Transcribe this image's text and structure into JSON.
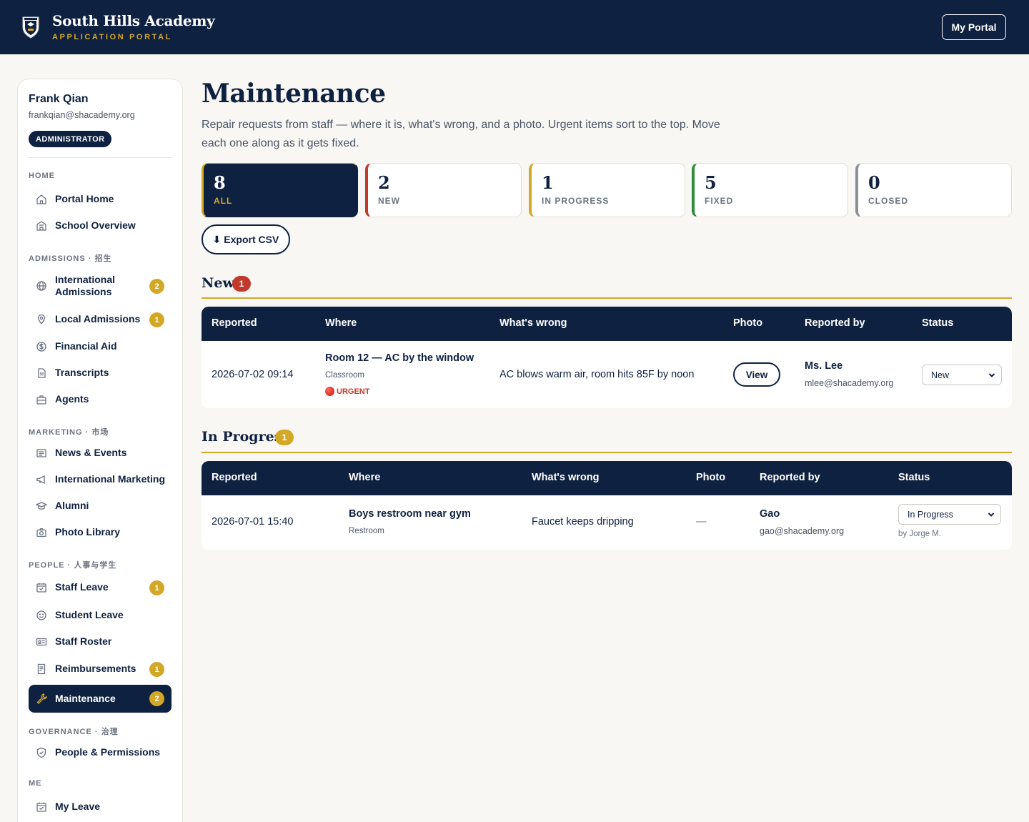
{
  "header": {
    "title": "South Hills Academy",
    "subtitle": "APPLICATION PORTAL",
    "portal_button": "My Portal"
  },
  "user": {
    "name": "Frank Qian",
    "email": "frankqian@shacademy.org",
    "role": "ADMINISTRATOR"
  },
  "nav": {
    "sections": {
      "home": "HOME",
      "admissions": "ADMISSIONS · 招生",
      "marketing": "MARKETING · 市场",
      "people": "PEOPLE · 人事与学生",
      "governance": "GOVERNANCE · 治理",
      "me": "ME"
    },
    "items": {
      "portal_home": {
        "label": "Portal Home",
        "icon": "home-icon"
      },
      "school_overview": {
        "label": "School Overview",
        "icon": "school-icon"
      },
      "international_admissions": {
        "label": "International Admissions",
        "icon": "globe-icon",
        "count": "2"
      },
      "local_admissions": {
        "label": "Local Admissions",
        "icon": "map-pin-icon",
        "count": "1"
      },
      "financial_aid": {
        "label": "Financial Aid",
        "icon": "dollar-icon"
      },
      "transcripts": {
        "label": "Transcripts",
        "icon": "document-icon"
      },
      "agents": {
        "label": "Agents",
        "icon": "briefcase-icon"
      },
      "news_events": {
        "label": "News & Events",
        "icon": "newspaper-icon"
      },
      "international_marketing": {
        "label": "International Marketing",
        "icon": "megaphone-icon"
      },
      "alumni": {
        "label": "Alumni",
        "icon": "graduation-cap-icon"
      },
      "photo_library": {
        "label": "Photo Library",
        "icon": "camera-icon"
      },
      "staff_leave": {
        "label": "Staff Leave",
        "icon": "calendar-check-icon",
        "count": "1"
      },
      "student_leave": {
        "label": "Student Leave",
        "icon": "smile-icon"
      },
      "staff_roster": {
        "label": "Staff Roster",
        "icon": "id-card-icon"
      },
      "reimbursements": {
        "label": "Reimbursements",
        "icon": "receipt-icon",
        "count": "1"
      },
      "maintenance": {
        "label": "Maintenance",
        "icon": "wrench-icon",
        "count": "2"
      },
      "people_permissions": {
        "label": "People & Permissions",
        "icon": "shield-icon"
      },
      "my_leave": {
        "label": "My Leave",
        "icon": "calendar-check-icon"
      }
    }
  },
  "page": {
    "title": "Maintenance",
    "description": "Repair requests from staff — where it is, what's wrong, and a photo. Urgent items sort to the top. Move each one along as it gets fixed."
  },
  "stats": [
    {
      "count": "8",
      "label": "ALL",
      "color": "#d4a827"
    },
    {
      "count": "2",
      "label": "NEW",
      "color": "#c0392b"
    },
    {
      "count": "1",
      "label": "IN PROGRESS",
      "color": "#d4a827"
    },
    {
      "count": "5",
      "label": "FIXED",
      "color": "#2e8b3e"
    },
    {
      "count": "0",
      "label": "CLOSED",
      "color": "#8a8f98"
    }
  ],
  "export_label": "⬇ Export CSV",
  "columns": {
    "reported": "Reported",
    "where": "Where",
    "whats_wrong": "What's wrong",
    "photo": "Photo",
    "reported_by": "Reported by",
    "status": "Status"
  },
  "sections": {
    "new": {
      "title": "New",
      "count": "1",
      "badge_color": "#c0392b",
      "row": {
        "reported": "2026-07-02 09:14",
        "where": "Room 12 — AC by the window",
        "location_type": "Classroom",
        "urgent": "URGENT",
        "whats_wrong": "AC blows warm air, room hits 85F by noon",
        "photo_button": "View",
        "reporter_name": "Ms. Lee",
        "reporter_email": "mlee@shacademy.org",
        "status": "New"
      }
    },
    "in_progress": {
      "title": "In Progress",
      "count": "1",
      "badge_color": "#d4a827",
      "row": {
        "reported": "2026-07-01 15:40",
        "where": "Boys restroom near gym",
        "location_type": "Restroom",
        "whats_wrong": "Faucet keeps dripping",
        "photo": "—",
        "reporter_name": "Gao",
        "reporter_email": "gao@shacademy.org",
        "status": "In Progress",
        "assignee": "by Jorge M."
      }
    }
  }
}
